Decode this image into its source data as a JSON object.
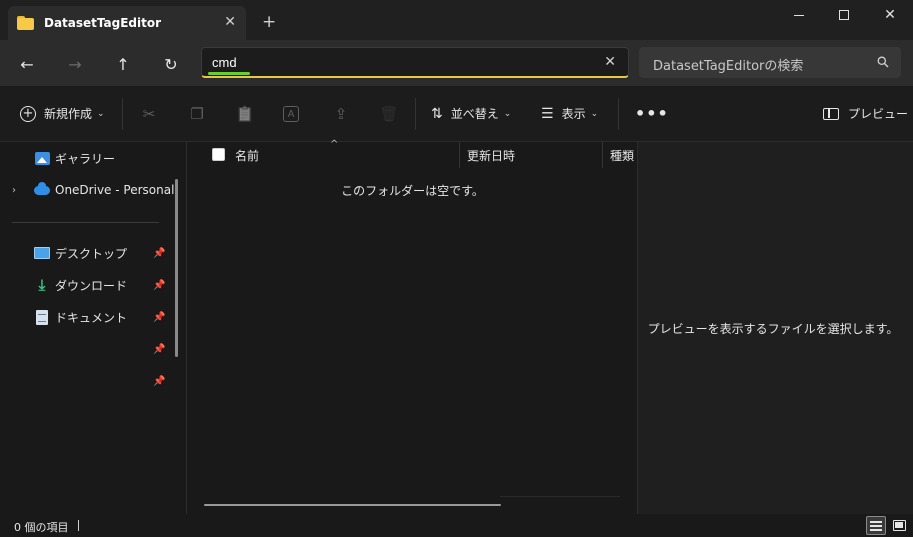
{
  "titlebar": {
    "tab_title": "DatasetTagEditor",
    "tab_close": "✕",
    "new_tab": "+",
    "close_glyph": "✕"
  },
  "nav": {
    "back": "←",
    "forward": "→",
    "up": "↑",
    "refresh": "↻",
    "address_value": "cmd",
    "clear": "✕",
    "search_placeholder": "DatasetTagEditorの検索"
  },
  "commands": {
    "new_label": "新規作成",
    "sort_label": "並べ替え",
    "view_label": "表示",
    "more": "•••",
    "preview_label": "プレビュー",
    "chevron": "⌄",
    "plus": "+",
    "cut_icon": "✂",
    "copy_icon": "❐",
    "paste_icon": "📋",
    "rename_icon": "A",
    "share_icon": "⇪",
    "delete_icon": "🗑",
    "sort_icon": "⇅",
    "view_icon": "☰"
  },
  "sidebar": {
    "gallery": "ギャラリー",
    "onedrive": "OneDrive - Personal",
    "desktop": "デスクトップ",
    "downloads": "ダウンロード",
    "documents": "ドキュメント",
    "pin": "📌",
    "expand": "›",
    "download_icon": "⤓"
  },
  "filelist": {
    "columns": [
      "名前",
      "更新日時",
      "種類"
    ],
    "sort_caret": "^",
    "empty_message": "このフォルダーは空です。"
  },
  "preview": {
    "message": "プレビューを表示するファイルを選択します。"
  },
  "status": {
    "item_count": "0 個の項目"
  }
}
